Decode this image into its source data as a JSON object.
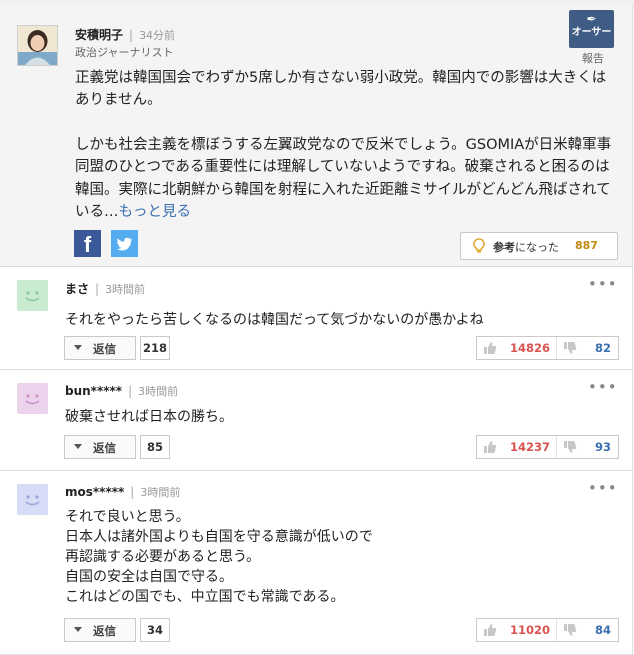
{
  "author_comment": {
    "name": "安積明子",
    "time": "34分前",
    "role": "政治ジャーナリスト",
    "badge": "オーサー",
    "report": "報告",
    "body_p1": "正義党は韓国国会でわずか5席しか有さない弱小政党。韓国内での影響は大きくはありません。",
    "body_p2": "しかも社会主義を標ぼうする左翼政党なので反米でしょう。GSOMIAが日米韓軍事同盟のひとつである重要性には理解していないようですね。破棄されると困るのは韓国。実際に北朝鮮から韓国を射程に入れた近距離ミサイルがどんどん飛ばされている…",
    "more": "もっと見る",
    "helpful_label": "参考",
    "helpful_suffix": "になった",
    "helpful_count": "887"
  },
  "comments": [
    {
      "user": "まさ",
      "time": "3時間前",
      "lines": [
        "それをやったら苦しくなるのは韓国だって気づかないのが愚かよね"
      ],
      "reply_label": "返信",
      "reply_count": "218",
      "likes": "14826",
      "dislikes": "82",
      "avatar_color": "#c9ecd0",
      "avatar_face": "#8ccc98"
    },
    {
      "user": "bun*****",
      "time": "3時間前",
      "lines": [
        "破棄させれば日本の勝ち。"
      ],
      "reply_label": "返信",
      "reply_count": "85",
      "likes": "14237",
      "dislikes": "93",
      "avatar_color": "#ecd3ec",
      "avatar_face": "#c993c9"
    },
    {
      "user": "mos*****",
      "time": "3時間前",
      "lines": [
        "それで良いと思う。",
        "日本人は諸外国よりも自国を守る意識が低いので",
        "再認識する必要があると思う。",
        "自国の安全は自国で守る。",
        "これはどの国でも、中立国でも常識である。"
      ],
      "reply_label": "返信",
      "reply_count": "34",
      "likes": "11020",
      "dislikes": "84",
      "avatar_color": "#d6dcf5",
      "avatar_face": "#9aa7dc"
    }
  ]
}
